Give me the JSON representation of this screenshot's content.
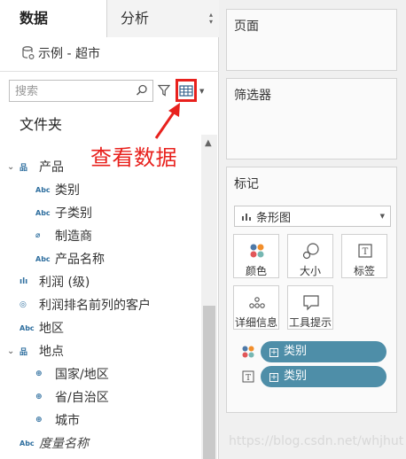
{
  "tabs": {
    "data": "数据",
    "analysis": "分析"
  },
  "datasource": {
    "name": "示例 - 超市"
  },
  "search": {
    "placeholder": "搜索"
  },
  "folder_label": "文件夹",
  "annotation": {
    "text": "查看数据",
    "color": "#e8211d"
  },
  "fields": [
    {
      "label": "产品",
      "icon": "hierarchy-icon",
      "indent": 1,
      "chevron": "⌄"
    },
    {
      "label": "类别",
      "icon": "abc-icon",
      "indent": 2
    },
    {
      "label": "子类别",
      "icon": "abc-icon",
      "indent": 2
    },
    {
      "label": "制造商",
      "icon": "paperclip-icon",
      "indent": 2
    },
    {
      "label": "产品名称",
      "icon": "abc-icon",
      "indent": 2
    },
    {
      "label": "利润 (级)",
      "icon": "bin-icon",
      "indent": 1
    },
    {
      "label": "利润排名前列的客户",
      "icon": "set-icon",
      "indent": 1
    },
    {
      "label": "地区",
      "icon": "abc-icon",
      "indent": 1
    },
    {
      "label": "地点",
      "icon": "hierarchy-icon",
      "indent": 1,
      "chevron": "⌄"
    },
    {
      "label": "国家/地区",
      "icon": "globe-icon",
      "indent": 2
    },
    {
      "label": "省/自治区",
      "icon": "globe-icon",
      "indent": 2
    },
    {
      "label": "城市",
      "icon": "globe-icon",
      "indent": 2
    },
    {
      "label": "度量名称",
      "icon": "abc-icon",
      "indent": 1,
      "italic": true
    }
  ],
  "shelves": {
    "pages": "页面",
    "filters": "筛选器",
    "marks": "标记"
  },
  "marks": {
    "type": "条形图",
    "buttons": {
      "color": "颜色",
      "size": "大小",
      "label": "标签",
      "detail": "详细信息",
      "tooltip": "工具提示"
    },
    "pills": [
      {
        "label": "类别",
        "encoding": "color"
      },
      {
        "label": "类别",
        "encoding": "label"
      }
    ],
    "pill_color": "#4e8ea8"
  },
  "watermark": "https://blog.csdn.net/whjhut"
}
